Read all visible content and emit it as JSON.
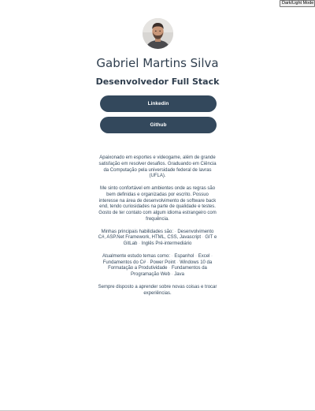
{
  "mode_toggle": {
    "label": "Dark/Light Mode"
  },
  "profile": {
    "name": "Gabriel Martins Silva",
    "role": "Desenvolvedor Full Stack"
  },
  "links": {
    "linkedin_label": "Linkedin",
    "github_label": "Github"
  },
  "about": {
    "intro": "Apaixonado em esportes e videogame, além de grande satisfação em resolver desafios. Graduando em Ciência da Computação pela universidade federal de lavras (UFLA).",
    "work": "Me sinto confortável em ambientes onde as regras são bem definidas e organizadas por escrito. Possuo interesse na área de desenvolvimento de software back end, tendo curiosidades na parte de qualidade e testes. Gosto de ter contato com algum idioma estrangeiro com frequência.",
    "skills_intro": "Minhas principais habilidades são:",
    "skills": [
      "Desenvolvimento C#, ASP.Net Framework, HTML, CSS, Javascript",
      "GIT e GitLab",
      "Inglês Pré-intermediário"
    ],
    "studies_intro": "Atualmente estudo temas como:",
    "studies": [
      "Espanhol",
      "Excel",
      "Fundamentos do C#",
      "Power Point",
      "Windows 10 da Formatação a Produtividade",
      "Fundamentos da Programação Web",
      "Java"
    ],
    "closing": "Sempre disposto a aprender sobre novas coisas e trocar experiências."
  },
  "colors": {
    "button_bg": "#33485c",
    "text": "#2f3e4e",
    "background": "#ffffff"
  }
}
